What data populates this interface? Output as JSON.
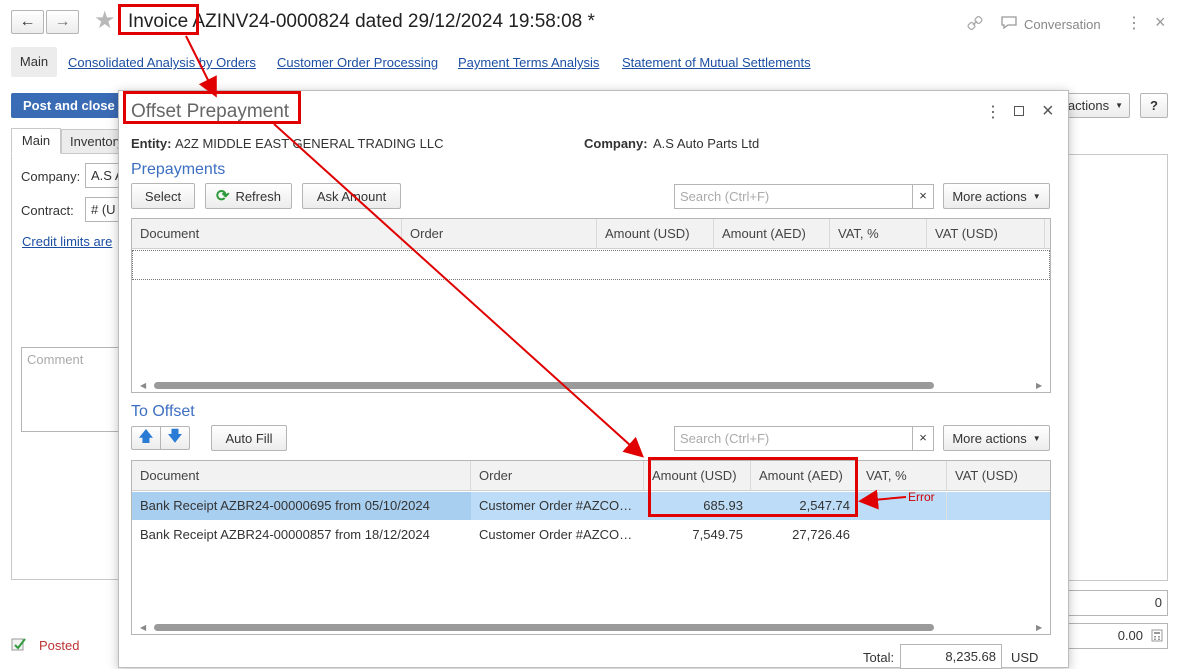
{
  "window": {
    "title": "Invoice AZINV24-0000824 dated 29/12/2024 19:58:08 *",
    "conversation_label": "Conversation",
    "close_glyph": "×",
    "more_glyph": "⋮"
  },
  "tabs": {
    "main": "Main",
    "links": [
      "Consolidated Analysis by Orders",
      "Customer Order Processing",
      "Payment Terms Analysis",
      "Statement of Mutual Settlements"
    ]
  },
  "form": {
    "post_close_label": "Post and close",
    "inner_tabs": [
      "Main",
      "Inventory"
    ],
    "company_label": "Company:",
    "company_value": "A.S A",
    "contract_label": "Contract:",
    "contract_value": "# (U",
    "credit_limits_label": "Credit limits are",
    "comment_placeholder": "Comment",
    "actions_label": "actions",
    "help_label": "?",
    "status_label": "Posted",
    "right_value_1": "0",
    "right_value_2": "0.00"
  },
  "dialog": {
    "title": "Offset Prepayment",
    "entity_label": "Entity:",
    "entity_value": "A2Z MIDDLE EAST GENERAL TRADING LLC",
    "company_label": "Company:",
    "company_value": "A.S Auto Parts Ltd",
    "prepayments_title": "Prepayments",
    "select_label": "Select",
    "refresh_label": "Refresh",
    "ask_amount_label": "Ask Amount",
    "search_placeholder": "Search (Ctrl+F)",
    "more_actions_label": "More actions",
    "clear_glyph": "×",
    "prepay_columns": [
      "Document",
      "Order",
      "Amount (USD)",
      "Amount (AED)",
      "VAT, %",
      "VAT (USD)"
    ],
    "to_offset_title": "To Offset",
    "auto_fill_label": "Auto Fill",
    "offset_columns": [
      "Document",
      "Order",
      "Amount (USD)",
      "Amount (AED)",
      "VAT, %",
      "VAT (USD)"
    ],
    "offset_rows": [
      {
        "document": "Bank Receipt AZBR24-00000695 from 05/10/2024",
        "order": "Customer Order #AZCO…",
        "usd": "685.93",
        "aed": "2,547.74",
        "vat_pct": "",
        "vat_usd": ""
      },
      {
        "document": "Bank Receipt AZBR24-00000857 from 18/12/2024",
        "order": "Customer Order #AZCO…",
        "usd": "7,549.75",
        "aed": "27,726.46",
        "vat_pct": "",
        "vat_usd": ""
      }
    ],
    "total_label": "Total:",
    "total_value": "8,235.68",
    "total_currency": "USD"
  },
  "annotation": {
    "error_label": "Error",
    "color": "#e00000"
  },
  "colors": {
    "accent": "#1c4fa3",
    "primary_button": "#3a6bb5",
    "selected_row": "#bcdcf7",
    "selected_cell": "#a9cff0",
    "refresh_icon": "#2e9a3a"
  }
}
